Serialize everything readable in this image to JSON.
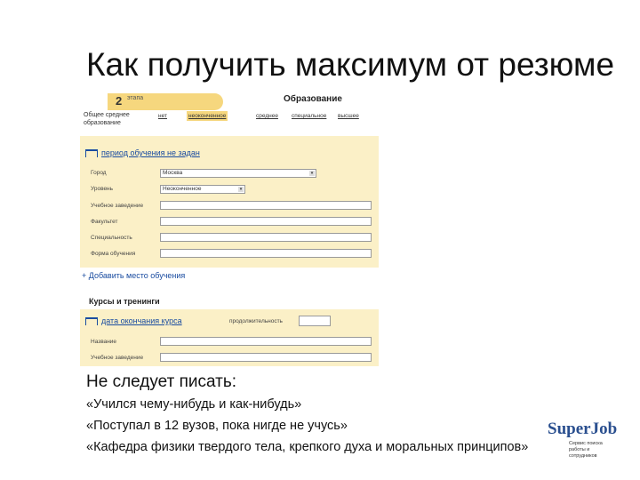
{
  "slide": {
    "title": "Как получить максимум от резюме"
  },
  "form": {
    "step_number": "2",
    "step_label": "этапа",
    "section_title": "Образование",
    "education_level_label": "Общее среднее образование",
    "education_options": [
      "нет",
      "неоконченное",
      "среднее",
      "специальное",
      "высшее"
    ],
    "selected_option_index": 1,
    "period_link": "период обучения не задан",
    "fields": [
      {
        "label": "Город",
        "value": "Москва",
        "kind": "city"
      },
      {
        "label": "Уровень",
        "value": "Неоконченное",
        "kind": "level"
      },
      {
        "label": "Учебное заведение",
        "value": "",
        "kind": "long"
      },
      {
        "label": "Факультет",
        "value": "",
        "kind": "long"
      },
      {
        "label": "Специальность",
        "value": "",
        "kind": "long"
      },
      {
        "label": "Форма обучения",
        "value": "",
        "kind": "long"
      }
    ],
    "add_place_link": "+ Добавить место обучения",
    "courses_title": "Курсы и тренинги",
    "course_end_link": "дата окончания курса",
    "duration_label": "продолжительность",
    "course_fields": [
      {
        "label": "Название",
        "value": ""
      },
      {
        "label": "Учебное заведение",
        "value": ""
      }
    ]
  },
  "advice": {
    "heading": "Не следует писать:",
    "items": [
      "«Учился чему-нибудь и как-нибудь»",
      "«Поступал в 12 вузов, пока нигде не учусь»",
      "«Кафедра физики твердого тела, крепкого духа и моральных принципов»"
    ]
  },
  "logo": {
    "text": "SuperJob",
    "subtitle": "Сервис поиска работы и сотрудников"
  },
  "colors": {
    "panel": "#fbf0c7",
    "tab": "#f6d77e",
    "link": "#1a4ca0",
    "logo": "#2a4f8f"
  }
}
